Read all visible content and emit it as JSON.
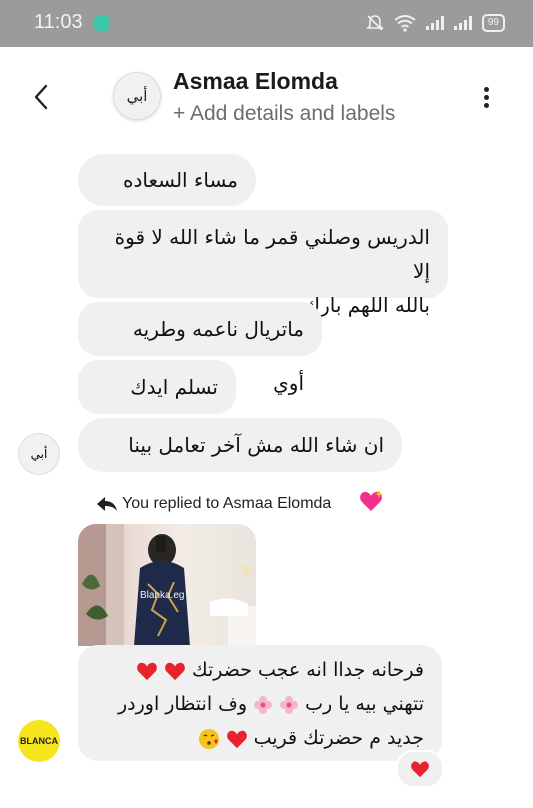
{
  "status": {
    "time": "11:03",
    "battery": "99"
  },
  "header": {
    "name": "Asmaa Elomda",
    "subtitle": "+ Add details and labels",
    "avatar_text": "أبي"
  },
  "messages": [
    {
      "text": "مساء السعاده"
    },
    {
      "line1": "الدريس وصلني قمر ما شاء الله لا قوة إلا",
      "line2": "بالله اللهم بارك"
    },
    {
      "text": "ماتريال ناعمه وطريه أوي"
    },
    {
      "text": "تسلم ايدك بجد"
    },
    {
      "text": "ان شاء الله مش آخر تعامل بينا"
    }
  ],
  "reply": {
    "label": "You replied to Asmaa Elomda",
    "photo_caption": "Blanka.eg"
  },
  "brand_message": {
    "line1": "فرحانه جداا انه عجب حضرتك",
    "line2a": "تتهني بيه يا رب",
    "line2b": "وف انتظار اوردر",
    "line3": "جديد م حضرتك قريب"
  },
  "brand_avatar_text": "BLANCA",
  "colors": {
    "status_bar": "#9b9b9b",
    "bubble": "#f0f0f0",
    "heart": "#e8232f",
    "brand": "#f6e51d"
  },
  "icons": [
    "back-icon",
    "more-icon",
    "bell-off-icon",
    "wifi-icon",
    "signal-icon",
    "heart-icon",
    "sparkle-heart-icon",
    "reply-arrow-icon",
    "blossom-icon",
    "kiss-emoji-icon"
  ]
}
